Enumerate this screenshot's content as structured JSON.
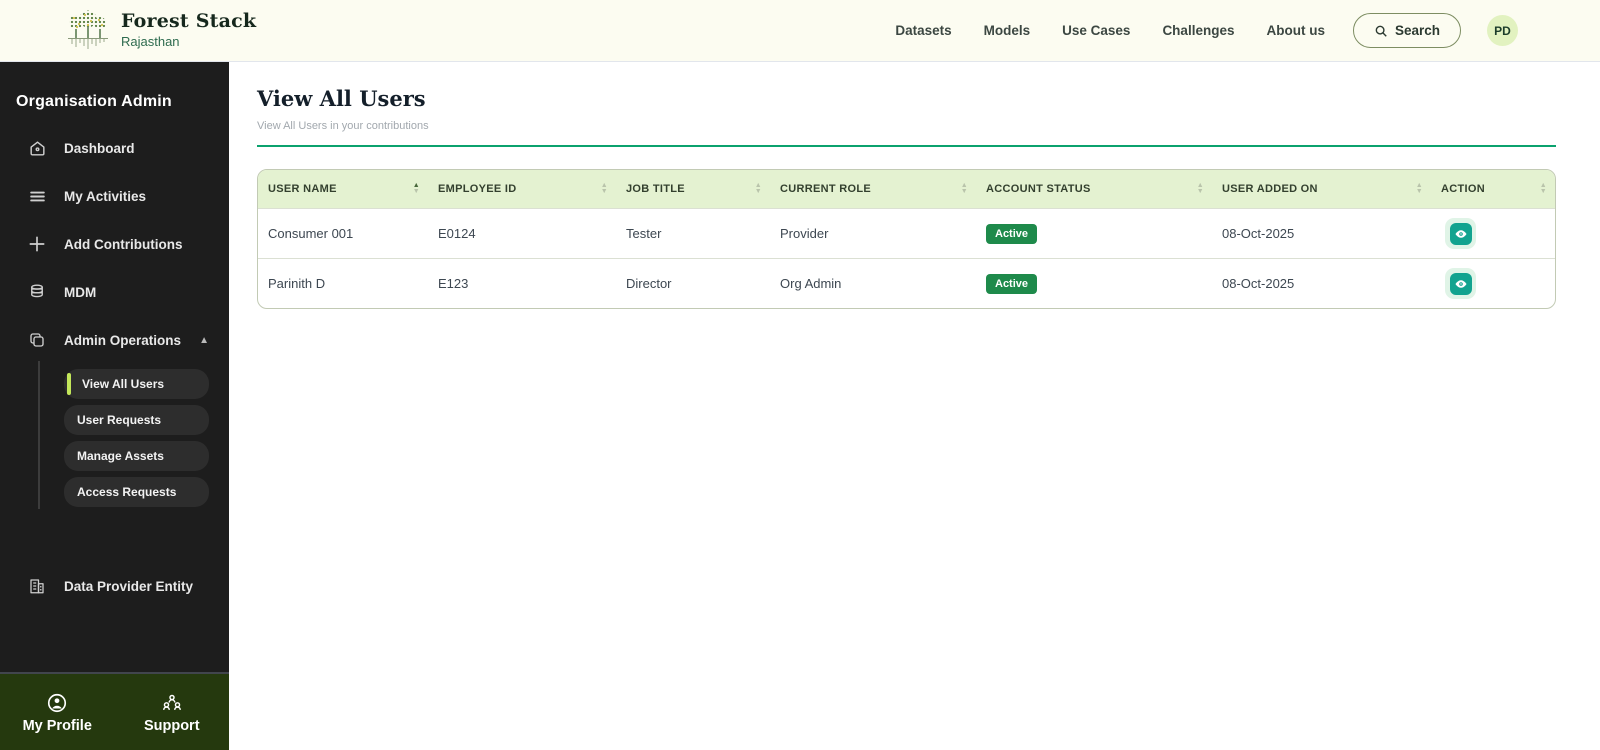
{
  "brand": {
    "name": "Forest Stack",
    "region": "Rajasthan"
  },
  "topnav": {
    "items": [
      "Datasets",
      "Models",
      "Use Cases",
      "Challenges",
      "About us"
    ],
    "search_label": "Search",
    "avatar_initials": "PD"
  },
  "sidebar": {
    "heading": "Organisation Admin",
    "items": [
      {
        "label": "Dashboard",
        "icon": "home-icon"
      },
      {
        "label": "My Activities",
        "icon": "list-icon"
      },
      {
        "label": "Add Contributions",
        "icon": "plus-icon"
      },
      {
        "label": "MDM",
        "icon": "database-icon"
      },
      {
        "label": "Admin Operations",
        "icon": "copy-icon",
        "expanded": true
      },
      {
        "label": "Data Provider Entity",
        "icon": "building-icon"
      }
    ],
    "admin_sub_items": [
      {
        "label": "View All Users",
        "active": true
      },
      {
        "label": "User Requests",
        "active": false
      },
      {
        "label": "Manage Assets",
        "active": false
      },
      {
        "label": "Access Requests",
        "active": false
      }
    ],
    "chevron_up": "▲",
    "footer": {
      "profile_label": "My Profile",
      "support_label": "Support"
    }
  },
  "page": {
    "title": "View All Users",
    "subtitle": "View All Users in your contributions"
  },
  "table": {
    "columns": [
      {
        "label": "USER NAME",
        "sorted": "asc"
      },
      {
        "label": "EMPLOYEE ID",
        "sorted": "none"
      },
      {
        "label": "JOB TITLE",
        "sorted": "none"
      },
      {
        "label": "CURRENT ROLE",
        "sorted": "none"
      },
      {
        "label": "ACCOUNT STATUS",
        "sorted": "none"
      },
      {
        "label": "USER ADDED ON",
        "sorted": "none"
      },
      {
        "label": "ACTION",
        "sorted": "none"
      }
    ],
    "sort_up_glyph": "▲",
    "sort_down_glyph": "▼",
    "rows": [
      {
        "user_name": "Consumer 001",
        "employee_id": "E0124",
        "job_title": "Tester",
        "current_role": "Provider",
        "account_status": "Active",
        "user_added_on": "08-Oct-2025"
      },
      {
        "user_name": "Parinith D",
        "employee_id": "E123",
        "job_title": "Director",
        "current_role": "Org Admin",
        "account_status": "Active",
        "user_added_on": "08-Oct-2025"
      }
    ]
  },
  "colors": {
    "topbar_bg": "#fcfcf1",
    "sidebar_bg": "#1d1d1d",
    "footer_green": "#25390e",
    "accent_rule_green": "#0ba26e",
    "table_header_green": "#e4f2d1",
    "badge_green": "#1e8a4b",
    "action_teal": "#12a38f",
    "active_lime": "#c3e75a",
    "avatar_bg": "#e2f2c0"
  }
}
